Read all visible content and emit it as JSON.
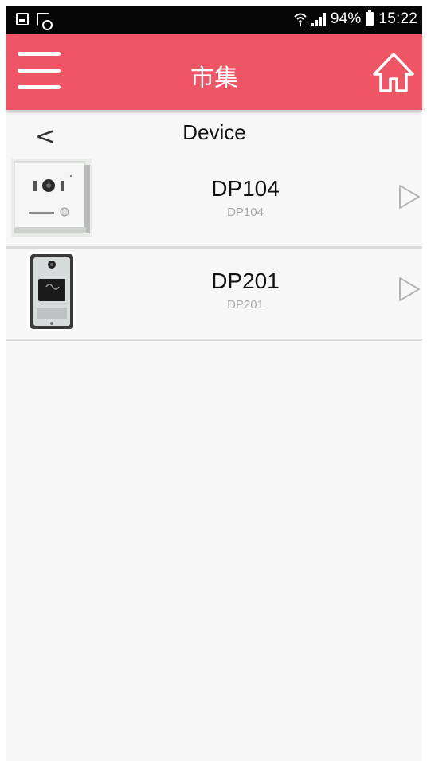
{
  "status_bar": {
    "battery": "94%",
    "time": "15:22",
    "icons": [
      "image-icon",
      "calendar-icon",
      "wifi-icon",
      "signal-icon",
      "battery-icon"
    ]
  },
  "header": {
    "title": "市集",
    "menu_icon": "hamburger-menu-icon",
    "home_icon": "home-icon",
    "background": "#ee5565"
  },
  "subheader": {
    "back": "<",
    "title": "Device"
  },
  "devices": [
    {
      "name": "DP104",
      "subtitle": "DP104",
      "thumbnail_icon": "doorbell-square-thumbnail",
      "arrow_icon": "play-arrow-icon"
    },
    {
      "name": "DP201",
      "subtitle": "DP201",
      "thumbnail_icon": "doorbell-tall-thumbnail",
      "arrow_icon": "play-arrow-icon"
    }
  ]
}
